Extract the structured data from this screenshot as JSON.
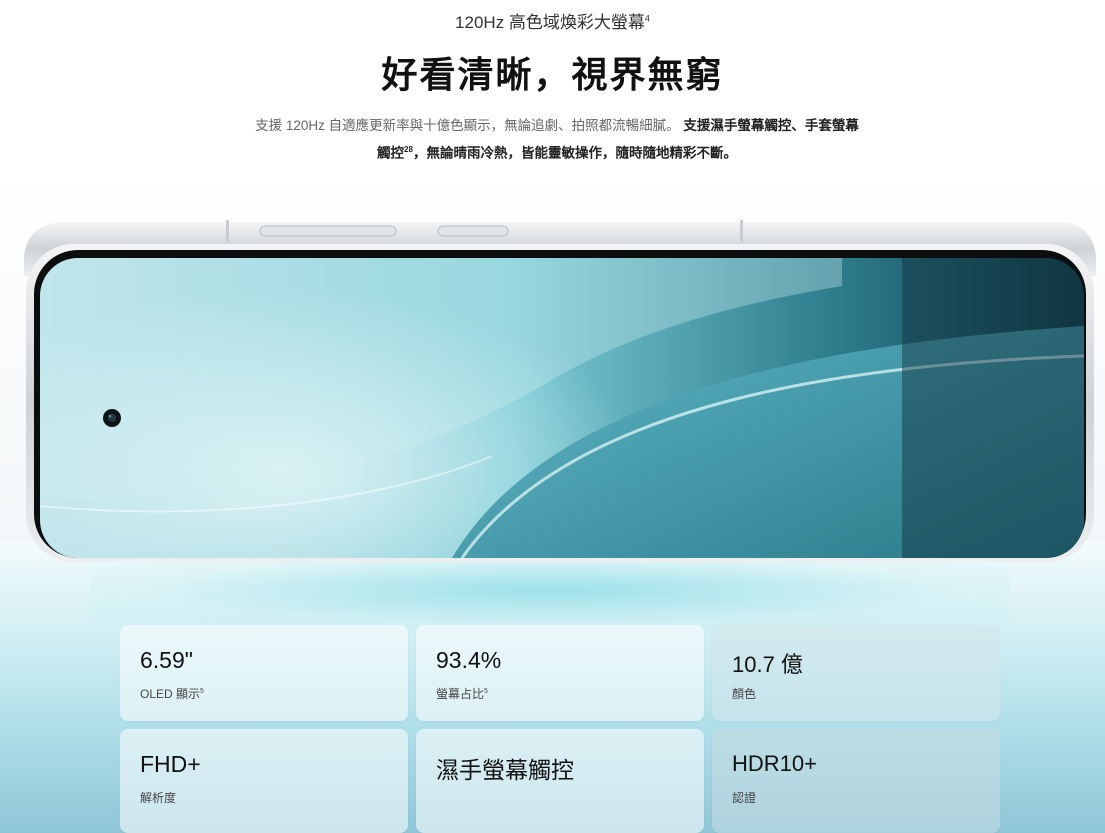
{
  "header": {
    "eyebrow": "120Hz 高色域煥彩大螢幕",
    "eyebrow_footnote": "4",
    "headline": "好看清晰，視界無窮",
    "desc_part1": "支援 120Hz 自適應更新率與十億色顯示，無論追劇、拍照都流暢細膩。",
    "desc_part2": "支援濕手螢幕觸控、手套螢幕觸控",
    "desc_footnote": "28",
    "desc_part3": "，無論晴雨冷熱，皆能靈敏操作，隨時隨地精彩不斷。"
  },
  "specs": [
    {
      "value": "6.59\"",
      "label": "OLED 顯示",
      "footnote": "5"
    },
    {
      "value": "93.4%",
      "label": "螢幕占比",
      "footnote": "5"
    },
    {
      "value": "10.7 億",
      "label": "顏色",
      "footnote": ""
    },
    {
      "value": "FHD+",
      "label": "解析度",
      "footnote": ""
    },
    {
      "value": "濕手螢幕觸控",
      "label": "",
      "footnote": ""
    },
    {
      "value": "HDR10+",
      "label": "認證",
      "footnote": ""
    }
  ],
  "colors": {
    "accent_teal": "#5fb8c8",
    "screen_dark": "#1c4a58",
    "frame_silver": "#d9dcdf"
  }
}
